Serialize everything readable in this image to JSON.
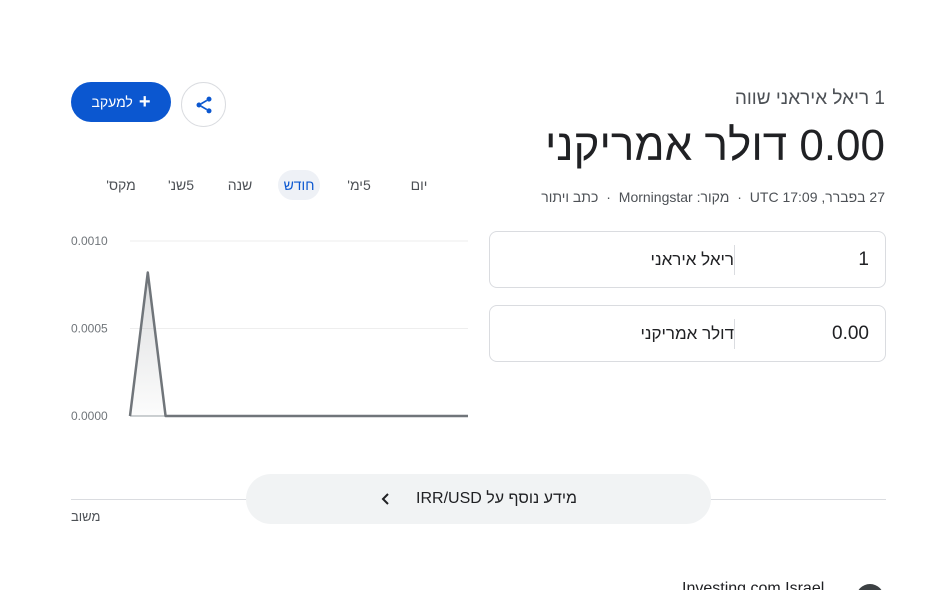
{
  "conversion": {
    "equivalence": "1 ריאל איראני שווה",
    "result": "0.00 דולר אמריקני",
    "meta": {
      "date": "27 בפברר, UTC 17:09",
      "source": "מקור: Morningstar",
      "disclaimer": "כתב ויתור"
    }
  },
  "converter": {
    "from": {
      "value": "1",
      "unit": "ריאל איראני"
    },
    "to": {
      "value": "0.00",
      "unit": "דולר אמריקני"
    }
  },
  "actions": {
    "follow_label": "למעקב",
    "share_icon": "share-icon"
  },
  "ranges": [
    "יום",
    "5ימ'",
    "חודש",
    "שנה",
    "5שנ'",
    "מקס'"
  ],
  "active_range": "חודש",
  "chart_data": {
    "type": "area",
    "x": [
      0,
      1,
      2,
      3,
      4,
      5,
      6,
      7,
      8,
      9,
      10,
      11,
      12,
      13,
      14,
      15,
      16,
      17,
      18,
      19
    ],
    "values": [
      0.0,
      0.00082,
      0.0,
      0.0,
      0.0,
      0.0,
      0.0,
      0.0,
      0.0,
      0.0,
      0.0,
      0.0,
      0.0,
      0.0,
      0.0,
      0.0,
      0.0,
      0.0,
      0.0,
      0.0
    ],
    "yticks": [
      "0.0010",
      "0.0005",
      "0.0000"
    ],
    "ylim": [
      0,
      0.001
    ],
    "grid": true,
    "line_color": "#70757a"
  },
  "more_info": {
    "label": "מידע נוסף על IRR/USD"
  },
  "feedback": "משוב",
  "next_result": {
    "title": "Investing.com Israel"
  }
}
